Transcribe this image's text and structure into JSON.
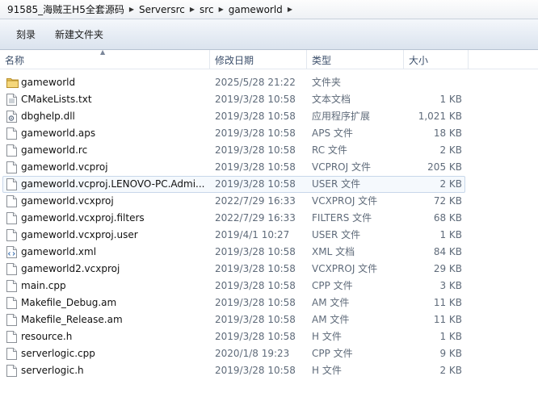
{
  "breadcrumb": [
    "91585_海贼王H5全套源码",
    "Serversrc",
    "src",
    "gameworld"
  ],
  "toolbar": {
    "burn_label": "刻录",
    "new_folder_label": "新建文件夹"
  },
  "columns": {
    "name": "名称",
    "date": "修改日期",
    "type": "类型",
    "size": "大小"
  },
  "files": [
    {
      "name": "gameworld",
      "date": "2025/5/28 21:22",
      "type": "文件夹",
      "size": "",
      "icon": "folder-icon"
    },
    {
      "name": "CMakeLists.txt",
      "date": "2019/3/28 10:58",
      "type": "文本文档",
      "size": "1 KB",
      "icon": "text-file-icon"
    },
    {
      "name": "dbghelp.dll",
      "date": "2019/3/28 10:58",
      "type": "应用程序扩展",
      "size": "1,021 KB",
      "icon": "dll-file-icon"
    },
    {
      "name": "gameworld.aps",
      "date": "2019/3/28 10:58",
      "type": "APS 文件",
      "size": "18 KB",
      "icon": "file-icon"
    },
    {
      "name": "gameworld.rc",
      "date": "2019/3/28 10:58",
      "type": "RC 文件",
      "size": "2 KB",
      "icon": "file-icon"
    },
    {
      "name": "gameworld.vcproj",
      "date": "2019/3/28 10:58",
      "type": "VCPROJ 文件",
      "size": "205 KB",
      "icon": "file-icon"
    },
    {
      "name": "gameworld.vcproj.LENOVO-PC.Admi...",
      "date": "2019/3/28 10:58",
      "type": "USER 文件",
      "size": "2 KB",
      "icon": "file-icon",
      "selected": true
    },
    {
      "name": "gameworld.vcxproj",
      "date": "2022/7/29 16:33",
      "type": "VCXPROJ 文件",
      "size": "72 KB",
      "icon": "file-icon"
    },
    {
      "name": "gameworld.vcxproj.filters",
      "date": "2022/7/29 16:33",
      "type": "FILTERS 文件",
      "size": "68 KB",
      "icon": "file-icon"
    },
    {
      "name": "gameworld.vcxproj.user",
      "date": "2019/4/1 10:27",
      "type": "USER 文件",
      "size": "1 KB",
      "icon": "file-icon"
    },
    {
      "name": "gameworld.xml",
      "date": "2019/3/28 10:58",
      "type": "XML 文档",
      "size": "84 KB",
      "icon": "xml-file-icon"
    },
    {
      "name": "gameworld2.vcxproj",
      "date": "2019/3/28 10:58",
      "type": "VCXPROJ 文件",
      "size": "29 KB",
      "icon": "file-icon"
    },
    {
      "name": "main.cpp",
      "date": "2019/3/28 10:58",
      "type": "CPP 文件",
      "size": "3 KB",
      "icon": "file-icon"
    },
    {
      "name": "Makefile_Debug.am",
      "date": "2019/3/28 10:58",
      "type": "AM 文件",
      "size": "11 KB",
      "icon": "file-icon"
    },
    {
      "name": "Makefile_Release.am",
      "date": "2019/3/28 10:58",
      "type": "AM 文件",
      "size": "11 KB",
      "icon": "file-icon"
    },
    {
      "name": "resource.h",
      "date": "2019/3/28 10:58",
      "type": "H 文件",
      "size": "1 KB",
      "icon": "file-icon"
    },
    {
      "name": "serverlogic.cpp",
      "date": "2020/1/8 19:23",
      "type": "CPP 文件",
      "size": "9 KB",
      "icon": "file-icon"
    },
    {
      "name": "serverlogic.h",
      "date": "2019/3/28 10:58",
      "type": "H 文件",
      "size": "2 KB",
      "icon": "file-icon"
    }
  ],
  "colors": {
    "selection_border": "#c8d7ea",
    "header_text": "#3c4f6b",
    "folder": "#e8c35a"
  }
}
